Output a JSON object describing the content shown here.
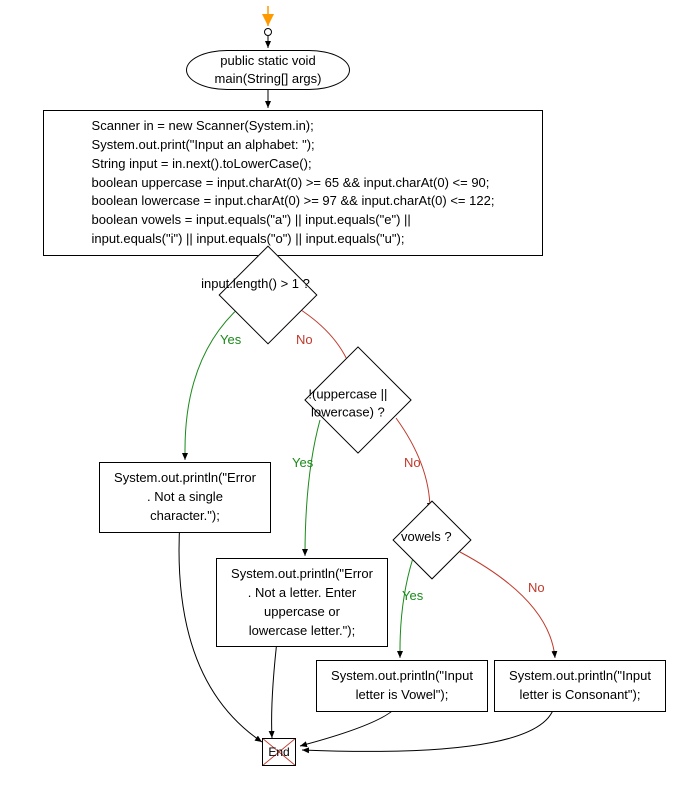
{
  "nodes": {
    "main_sig": "public static void\nmain(String[] args)",
    "init_block": "Scanner in = new Scanner(System.in);\nSystem.out.print(\"Input an alphabet: \");\nString input = in.next().toLowerCase();\nboolean uppercase = input.charAt(0) >= 65 && input.charAt(0) <= 90;\nboolean lowercase = input.charAt(0) >= 97 && input.charAt(0) <= 122;\nboolean vowels = input.equals(\"a\") || input.equals(\"e\") ||\ninput.equals(\"i\") || input.equals(\"o\") || input.equals(\"u\");",
    "cond_len": "input.length() > 1 ?",
    "cond_letter": "!(uppercase ||\nlowercase) ?",
    "err_single": "System.out.println(\"Error\n. Not a single\ncharacter.\");",
    "err_letter": "System.out.println(\"Error\n. Not a letter. Enter\nuppercase or\nlowercase letter.\");",
    "cond_vowels": "vowels ?",
    "out_vowel": "System.out.println(\"Input\nletter is Vowel\");",
    "out_cons": "System.out.println(\"Input\nletter is Consonant\");",
    "end": "End"
  },
  "labels": {
    "yes": "Yes",
    "no": "No"
  },
  "colors": {
    "yes": "#1a8a1a",
    "no": "#c0392b",
    "arrow": "#ff9900"
  }
}
